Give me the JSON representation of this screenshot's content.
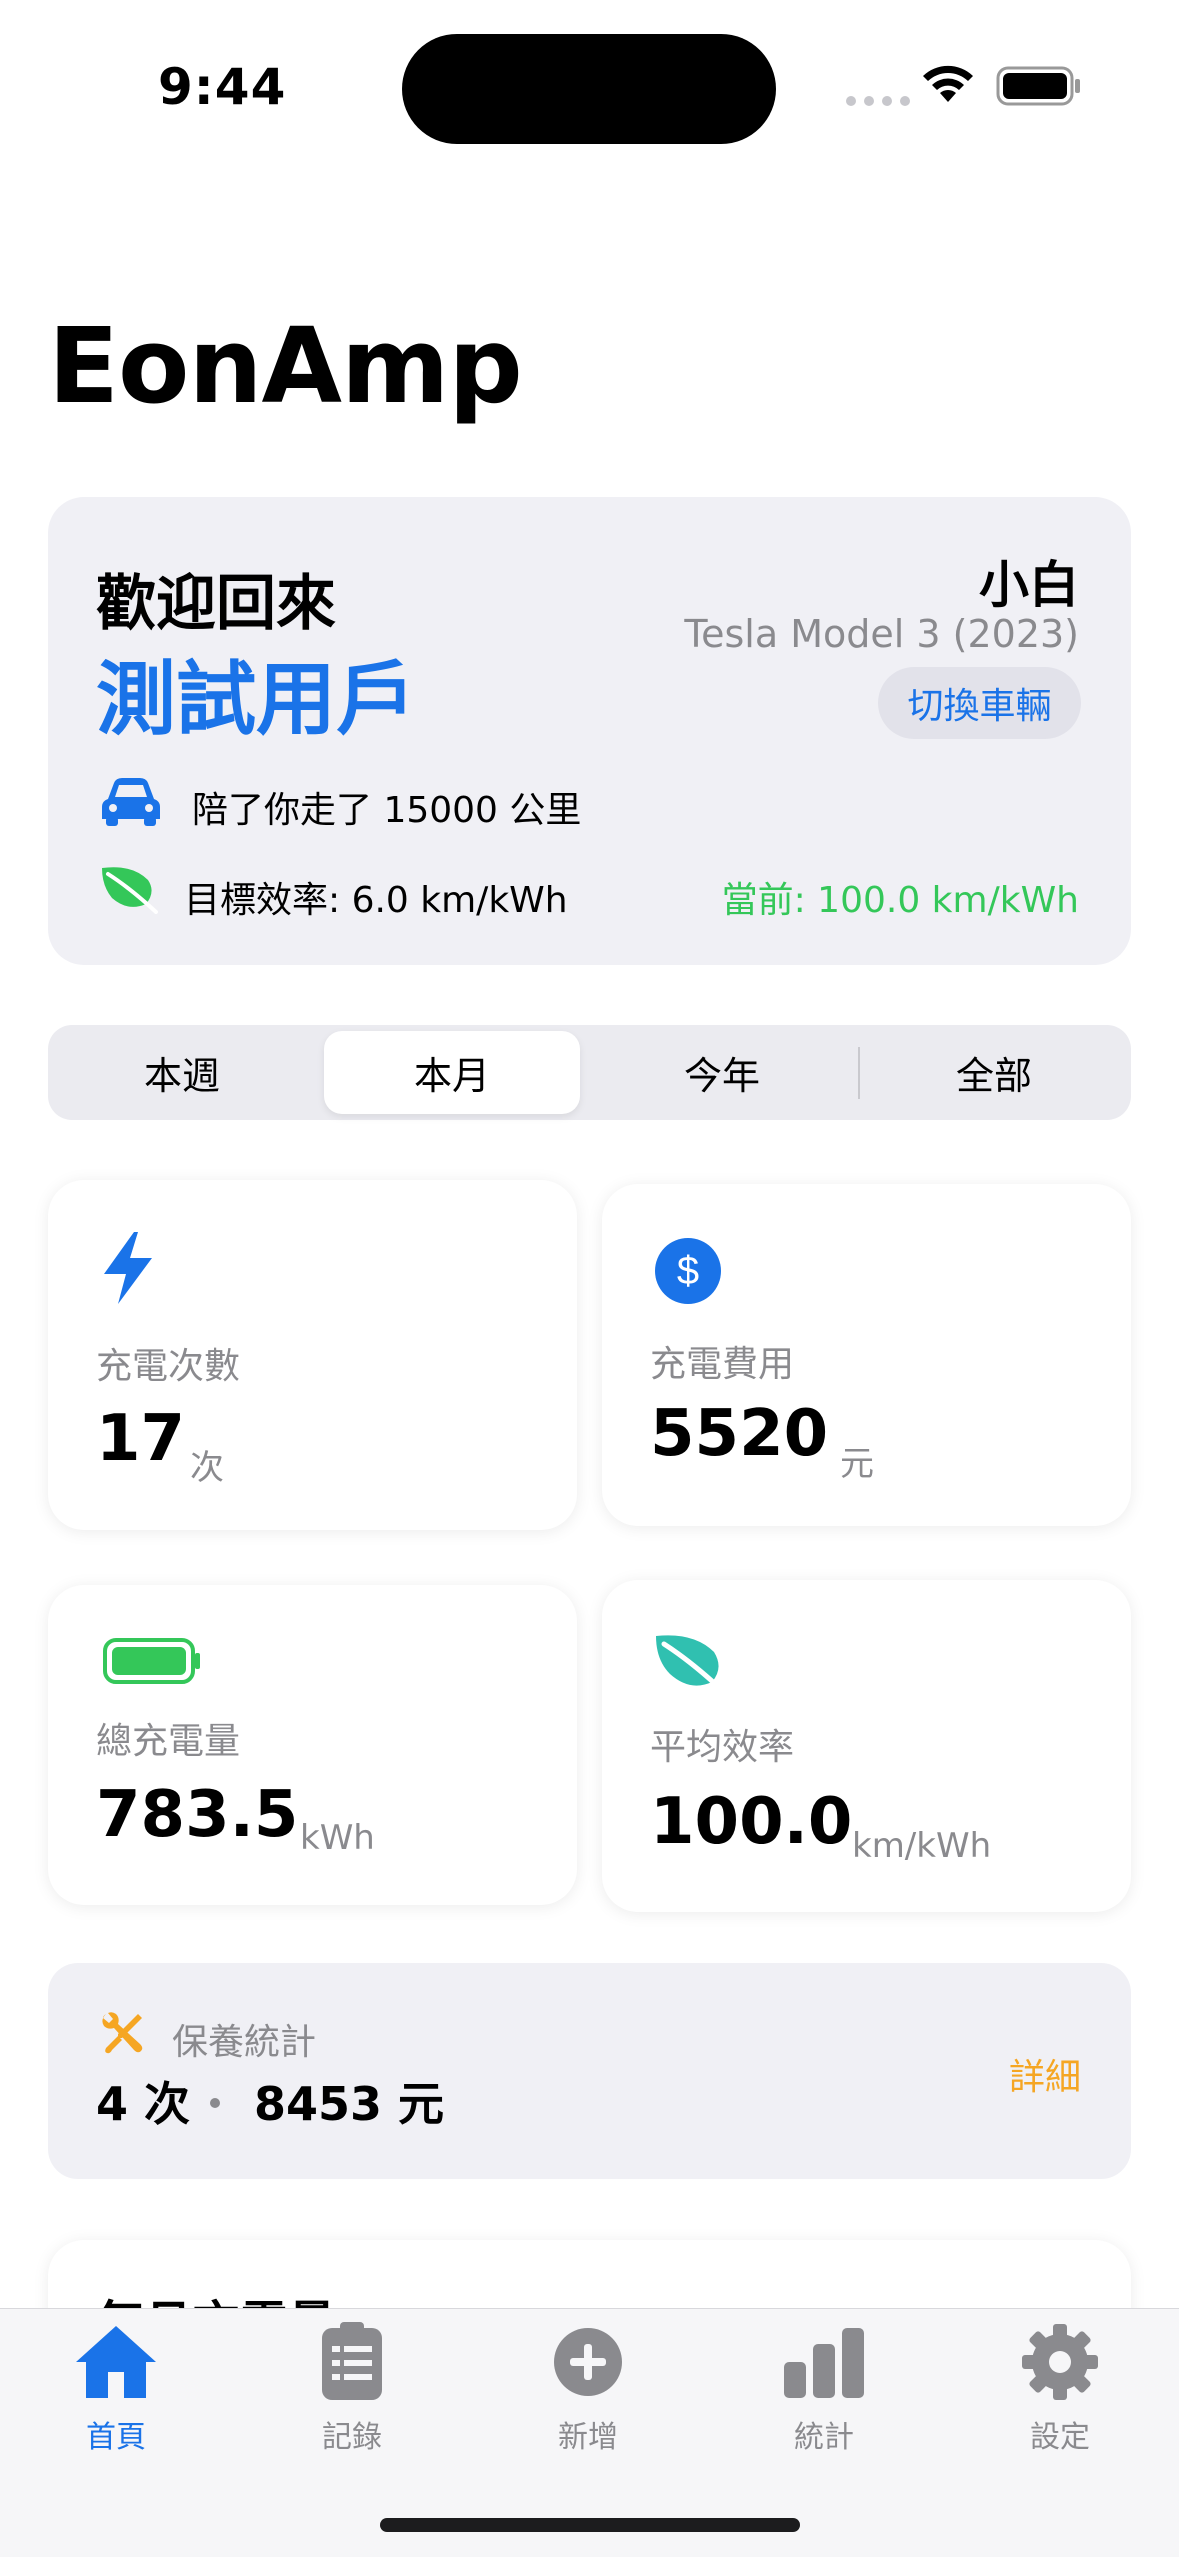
{
  "status_bar": {
    "time": "9:44"
  },
  "app": {
    "title": "EonAmp"
  },
  "welcome": {
    "label": "歡迎回來",
    "user_name": "測試用戶",
    "car_nickname": "小白",
    "car_model": "Tesla Model 3 (2023)",
    "switch_label": "切換車輛",
    "distance_text": "陪了你走了 15000 公里",
    "target_efficiency": "目標效率: 6.0 km/kWh",
    "current_efficiency": "當前: 100.0 km/kWh"
  },
  "period_tabs": [
    "本週",
    "本月",
    "今年",
    "全部"
  ],
  "period_selected": "本月",
  "stats": {
    "charge_count": {
      "label": "充電次數",
      "value": "17",
      "unit": "次"
    },
    "charge_cost": {
      "label": "充電費用",
      "value": "5520",
      "unit": "元"
    },
    "total_energy": {
      "label": "總充電量",
      "value": "783.5",
      "unit": "kWh"
    },
    "avg_efficiency": {
      "label": "平均效率",
      "value": "100.0",
      "unit": "km/kWh"
    }
  },
  "maintenance": {
    "label": "保養統計",
    "count": "4 次",
    "cost": "8453 元",
    "detail_label": "詳細"
  },
  "next_section": {
    "title": "每月充電量"
  },
  "tabbar": {
    "items": [
      {
        "label": "首頁",
        "icon": "house-icon",
        "active": true
      },
      {
        "label": "記錄",
        "icon": "clipboard-icon",
        "active": false
      },
      {
        "label": "新增",
        "icon": "plus-circle-icon",
        "active": false
      },
      {
        "label": "統計",
        "icon": "bar-chart-icon",
        "active": false
      },
      {
        "label": "設定",
        "icon": "gear-icon",
        "active": false
      }
    ]
  },
  "colors": {
    "accent": "#1a73e8",
    "green": "#34c759",
    "teal": "#30c0b0",
    "orange": "#f5a623",
    "card_bg": "#f0f0f5"
  }
}
